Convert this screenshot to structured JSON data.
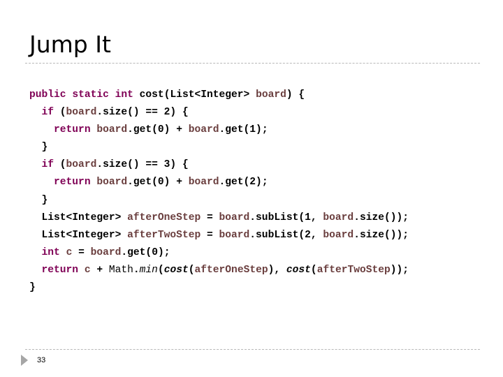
{
  "slide": {
    "title": "Jump It",
    "page_number": "33",
    "colors": {
      "keyword": "#7F0055",
      "variable": "#6A3E3E",
      "text": "#000000",
      "rule": "#b8b8b8",
      "footer_marker": "#a6a6a6"
    }
  },
  "code": {
    "language": "java",
    "lines": [
      [
        {
          "t": "public",
          "k": "kw"
        },
        {
          "t": " ",
          "k": "plain"
        },
        {
          "t": "static",
          "k": "kw"
        },
        {
          "t": " ",
          "k": "plain"
        },
        {
          "t": "int",
          "k": "kw"
        },
        {
          "t": " cost(List<Integer> ",
          "k": "plain"
        },
        {
          "t": "board",
          "k": "var"
        },
        {
          "t": ") {",
          "k": "plain"
        }
      ],
      [
        {
          "t": "  ",
          "k": "plain"
        },
        {
          "t": "if",
          "k": "kw"
        },
        {
          "t": " (",
          "k": "plain"
        },
        {
          "t": "board",
          "k": "var"
        },
        {
          "t": ".size() == 2) {",
          "k": "plain"
        }
      ],
      [
        {
          "t": "    ",
          "k": "plain"
        },
        {
          "t": "return",
          "k": "kw"
        },
        {
          "t": " ",
          "k": "plain"
        },
        {
          "t": "board",
          "k": "var"
        },
        {
          "t": ".get(0) + ",
          "k": "plain"
        },
        {
          "t": "board",
          "k": "var"
        },
        {
          "t": ".get(1);",
          "k": "plain"
        }
      ],
      [
        {
          "t": "  }",
          "k": "plain"
        }
      ],
      [
        {
          "t": "  ",
          "k": "plain"
        },
        {
          "t": "if",
          "k": "kw"
        },
        {
          "t": " (",
          "k": "plain"
        },
        {
          "t": "board",
          "k": "var"
        },
        {
          "t": ".size() == 3) {",
          "k": "plain"
        }
      ],
      [
        {
          "t": "    ",
          "k": "plain"
        },
        {
          "t": "return",
          "k": "kw"
        },
        {
          "t": " ",
          "k": "plain"
        },
        {
          "t": "board",
          "k": "var"
        },
        {
          "t": ".get(0) + ",
          "k": "plain"
        },
        {
          "t": "board",
          "k": "var"
        },
        {
          "t": ".get(2);",
          "k": "plain"
        }
      ],
      [
        {
          "t": "  }",
          "k": "plain"
        }
      ],
      [
        {
          "t": "  List<Integer> ",
          "k": "plain"
        },
        {
          "t": "afterOneStep",
          "k": "var"
        },
        {
          "t": " = ",
          "k": "plain"
        },
        {
          "t": "board",
          "k": "var"
        },
        {
          "t": ".subList(1, ",
          "k": "plain"
        },
        {
          "t": "board",
          "k": "var"
        },
        {
          "t": ".size());",
          "k": "plain"
        }
      ],
      [
        {
          "t": "  List<Integer> ",
          "k": "plain"
        },
        {
          "t": "afterTwoStep",
          "k": "var"
        },
        {
          "t": " = ",
          "k": "plain"
        },
        {
          "t": "board",
          "k": "var"
        },
        {
          "t": ".subList(2, ",
          "k": "plain"
        },
        {
          "t": "board",
          "k": "var"
        },
        {
          "t": ".size());",
          "k": "plain"
        }
      ],
      [
        {
          "t": "  ",
          "k": "plain"
        },
        {
          "t": "int",
          "k": "kw"
        },
        {
          "t": " ",
          "k": "plain"
        },
        {
          "t": "c",
          "k": "var"
        },
        {
          "t": " = ",
          "k": "plain"
        },
        {
          "t": "board",
          "k": "var"
        },
        {
          "t": ".get(0);",
          "k": "plain"
        }
      ],
      [
        {
          "t": "  ",
          "k": "plain"
        },
        {
          "t": "return",
          "k": "kw"
        },
        {
          "t": " ",
          "k": "plain"
        },
        {
          "t": "c",
          "k": "var"
        },
        {
          "t": " + ",
          "k": "plain"
        },
        {
          "t": "Math",
          "k": "static-class"
        },
        {
          "t": ".",
          "k": "plain"
        },
        {
          "t": "min",
          "k": "static-method"
        },
        {
          "t": "(",
          "k": "plain"
        },
        {
          "t": "cost",
          "k": "static-call"
        },
        {
          "t": "(",
          "k": "plain"
        },
        {
          "t": "afterOneStep",
          "k": "var"
        },
        {
          "t": "), ",
          "k": "plain"
        },
        {
          "t": "cost",
          "k": "static-call"
        },
        {
          "t": "(",
          "k": "plain"
        },
        {
          "t": "afterTwoStep",
          "k": "var"
        },
        {
          "t": "));",
          "k": "plain"
        }
      ],
      [
        {
          "t": "}",
          "k": "plain"
        }
      ]
    ]
  }
}
